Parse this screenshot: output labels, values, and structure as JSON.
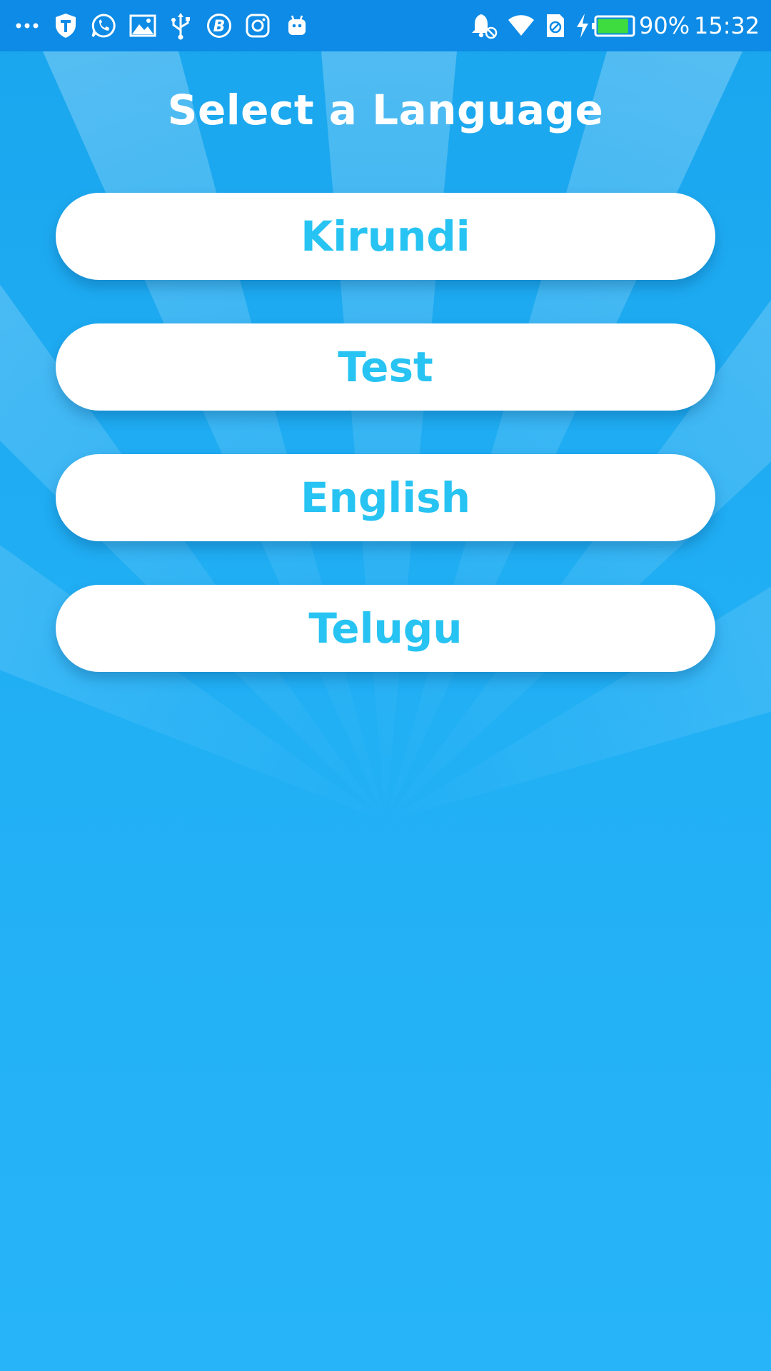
{
  "status_bar": {
    "left_icons": [
      "more-dots-icon",
      "shield-icon",
      "whatsapp-icon",
      "gallery-icon",
      "usb-icon",
      "b-app-icon",
      "instagram-icon",
      "android-icon"
    ],
    "right_icons": [
      "alarm-muted-icon",
      "wifi-icon",
      "no-sim-icon",
      "charging-icon",
      "battery-icon"
    ],
    "battery_level": 0.9,
    "battery_text": "90%",
    "time": "15:32"
  },
  "screen": {
    "title": "Select a Language",
    "languages": [
      {
        "label": "Kirundi"
      },
      {
        "label": "Test"
      },
      {
        "label": "English"
      },
      {
        "label": "Telugu"
      }
    ]
  },
  "colors": {
    "background": "#27b4f8",
    "status_bar": "#0d8be6",
    "button_background": "#ffffff",
    "button_text": "#27c3f2",
    "battery_fill": "#3fdc3f"
  }
}
